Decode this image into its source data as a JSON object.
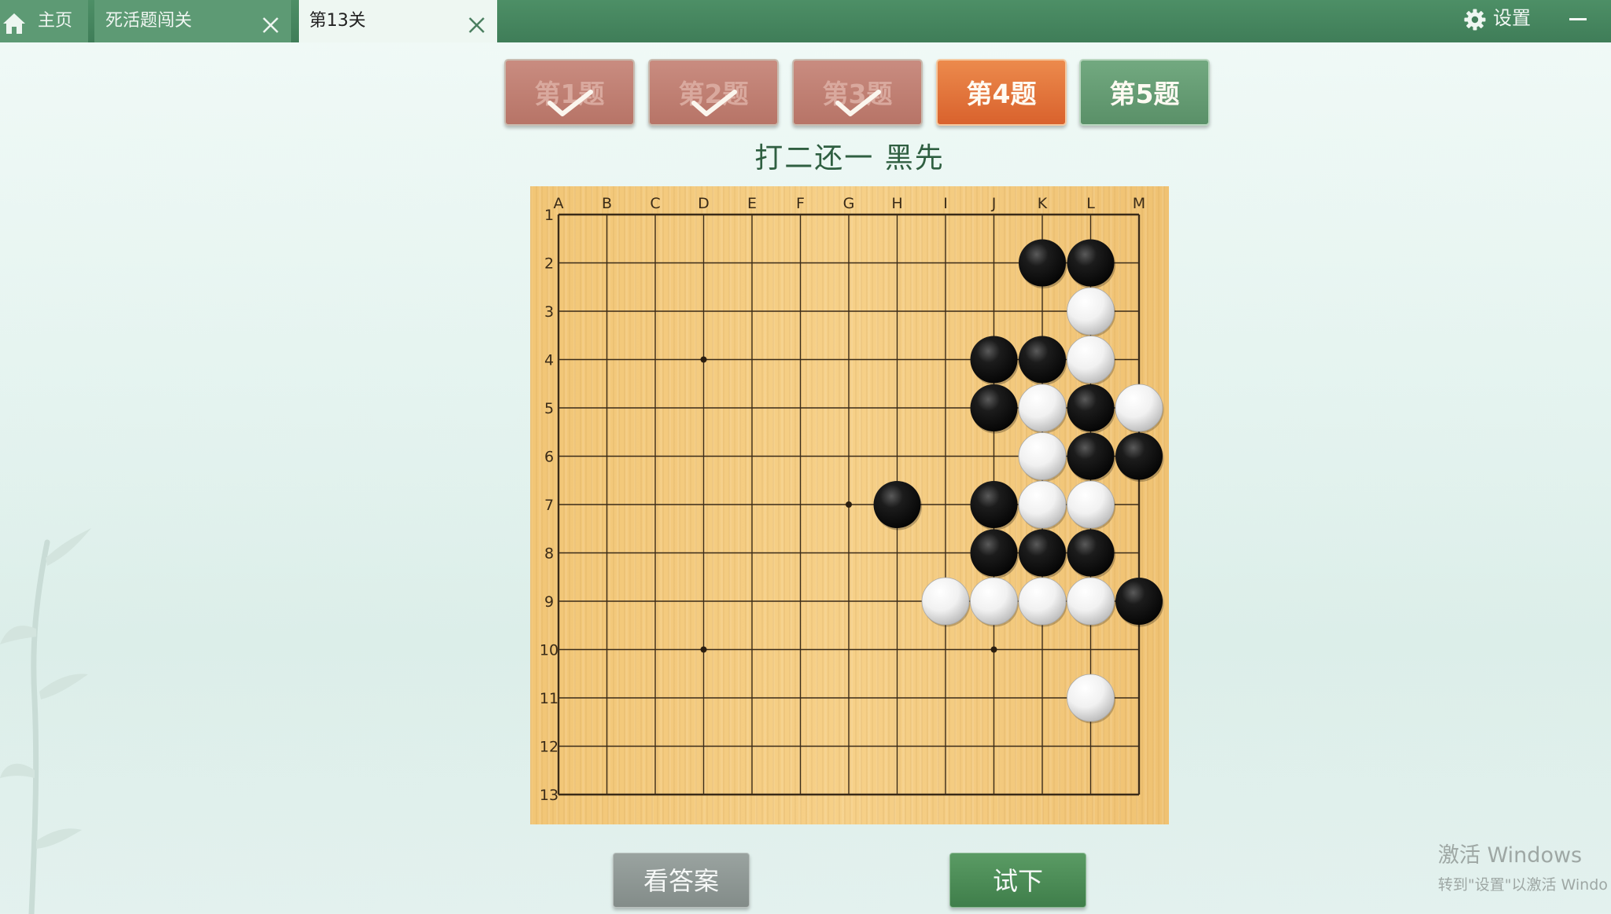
{
  "tabs": {
    "home_label": "主页",
    "puzzle_label": "死活题闯关",
    "level_label": "第13关"
  },
  "settings_label": "设置",
  "problems": [
    {
      "label": "第1题",
      "status": "done"
    },
    {
      "label": "第2题",
      "status": "done"
    },
    {
      "label": "第3题",
      "status": "done"
    },
    {
      "label": "第4题",
      "status": "current"
    },
    {
      "label": "第5题",
      "status": "next"
    }
  ],
  "problem_title": "打二还一  黑先",
  "board": {
    "columns": [
      "A",
      "B",
      "C",
      "D",
      "E",
      "F",
      "G",
      "H",
      "I",
      "J",
      "K",
      "L",
      "M"
    ],
    "rows": [
      "1",
      "2",
      "3",
      "4",
      "5",
      "6",
      "7",
      "8",
      "9",
      "10",
      "11",
      "12",
      "13"
    ],
    "star_points": [
      "D4",
      "G7",
      "D10",
      "J10"
    ],
    "stones": {
      "black": [
        "K2",
        "L2",
        "J4",
        "K4",
        "J5",
        "L5",
        "L6",
        "M6",
        "H7",
        "J7",
        "J8",
        "K8",
        "L8",
        "M9"
      ],
      "white": [
        "L3",
        "L4",
        "K5",
        "M5",
        "K6",
        "K7",
        "L7",
        "I9",
        "J9",
        "K9",
        "L9",
        "L11"
      ]
    }
  },
  "actions": {
    "answer_label": "看答案",
    "try_label": "试下"
  },
  "watermark": {
    "line1": "激活 Windows",
    "line2": "转到\"设置\"以激活 Windo"
  }
}
